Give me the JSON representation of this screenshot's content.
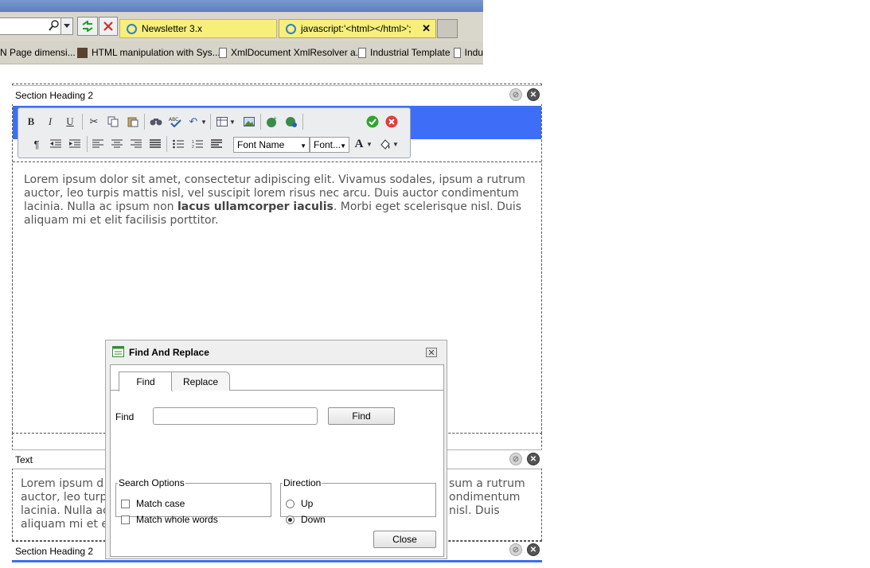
{
  "browser": {
    "tabs": [
      {
        "label": "Newsletter 3.x"
      },
      {
        "label": "javascript:'<html></html>';"
      }
    ],
    "close_tab_glyph": "✕",
    "favorites": [
      {
        "label": "N Page dimensi..."
      },
      {
        "label": "HTML manipulation with Sys..."
      },
      {
        "label": "XmlDocument XmlResolver a..."
      },
      {
        "label": "Industrial Template"
      },
      {
        "label": "Indu"
      }
    ]
  },
  "sections": [
    {
      "heading": "Section Heading 2"
    },
    {
      "heading": "Text"
    },
    {
      "heading": "Section Heading 2"
    }
  ],
  "editor": {
    "paragraph_start": "Lorem ipsum dolor sit amet, consectetur adipiscing elit. Vivamus sodales, ipsum a rutrum auctor, leo turpis mattis nisl, vel suscipit lorem risus nec arcu. Duis auctor condimentum lacinia. Nulla ac ipsum non ",
    "paragraph_bold": "lacus ullamcorper iaculis",
    "paragraph_end": ". Morbi eget scelerisque nisl. Duis aliquam mi et elit facilisis porttitor."
  },
  "text_section": {
    "lines": [
      {
        "left": "Lorem ipsum d",
        "right": "sum a rutrum"
      },
      {
        "left": "auctor, leo turp",
        "right": "ondimentum"
      },
      {
        "left": "lacinia. Nulla ac",
        "right": "nisl. Duis"
      },
      {
        "left": "aliquam mi et e",
        "right": ""
      }
    ]
  },
  "toolbar": {
    "bold": "B",
    "italic": "I",
    "underline": "U",
    "font_name": "Font Name",
    "font_size": "Font...",
    "font_color": "A"
  },
  "dialog": {
    "title": "Find And Replace",
    "tabs": [
      "Find",
      "Replace"
    ],
    "find_label": "Find",
    "find_value": "",
    "find_button": "Find",
    "search_options": {
      "legend": "Search Options",
      "match_case": {
        "label": "Match case",
        "checked": false
      },
      "match_whole_words": {
        "label": "Match whole words",
        "checked": false
      }
    },
    "direction": {
      "legend": "Direction",
      "up": {
        "label": "Up",
        "selected": false
      },
      "down": {
        "label": "Down",
        "selected": true
      }
    },
    "close_button": "Close"
  },
  "colors": {
    "tab_active": "#f7ef7a",
    "selection_bar": "#3e6df7",
    "ok_green": "#2fa62f",
    "cancel_red": "#e23a3a"
  }
}
